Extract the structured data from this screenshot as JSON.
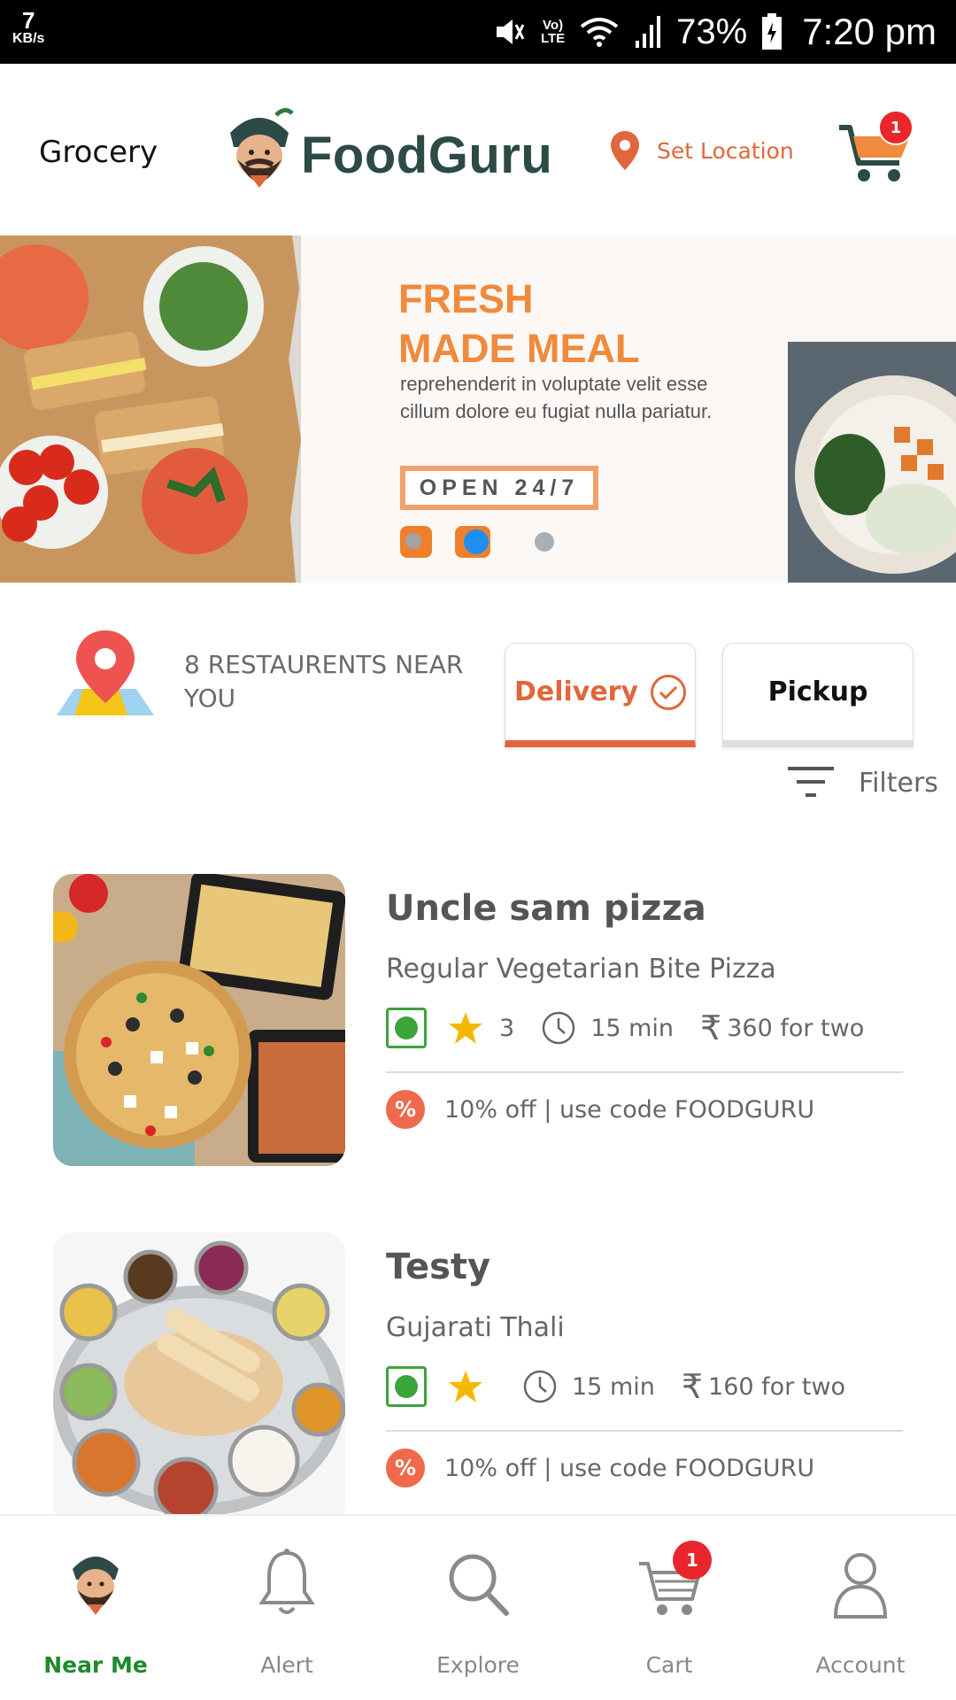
{
  "status_bar": {
    "net_speed": "7",
    "net_unit": "KB/s",
    "lte_top": "Vo)",
    "lte_bottom": "LTE",
    "battery": "73%",
    "time": "7:20 pm"
  },
  "header": {
    "grocery_label": "Grocery",
    "brand": "FoodGuru",
    "set_location": "Set Location",
    "cart_count": "1"
  },
  "banner": {
    "title_line1": "FRESH",
    "title_line2": "MADE MEAL",
    "text": "reprehenderit in voluptate velit esse cillum dolore eu fugiat nulla pariatur.",
    "button": "OPEN 24/7"
  },
  "near": {
    "text": "8 RESTAURENTS NEAR YOU"
  },
  "mode_tabs": {
    "delivery": "Delivery",
    "pickup": "Pickup"
  },
  "filters_label": "Filters",
  "restaurants": [
    {
      "name": "Uncle sam pizza",
      "desc": "Regular Vegetarian Bite Pizza",
      "rating": "3",
      "time": "15 min",
      "price": "360 for two",
      "offer": "10% off | use code FOODGURU"
    },
    {
      "name": "Testy",
      "desc": "Gujarati Thali",
      "rating": "",
      "time": "15 min",
      "price": "160 for two",
      "offer": "10% off | use code FOODGURU"
    }
  ],
  "bottom_nav": {
    "items": [
      {
        "label": "Near Me"
      },
      {
        "label": "Alert"
      },
      {
        "label": "Explore"
      },
      {
        "label": "Cart"
      },
      {
        "label": "Account"
      }
    ],
    "cart_badge": "1"
  },
  "colors": {
    "accent": "#e0673b",
    "brand": "#2c4a46",
    "active_nav": "#1d8a2d",
    "veg": "#3da33d",
    "badge": "#e8262b"
  }
}
